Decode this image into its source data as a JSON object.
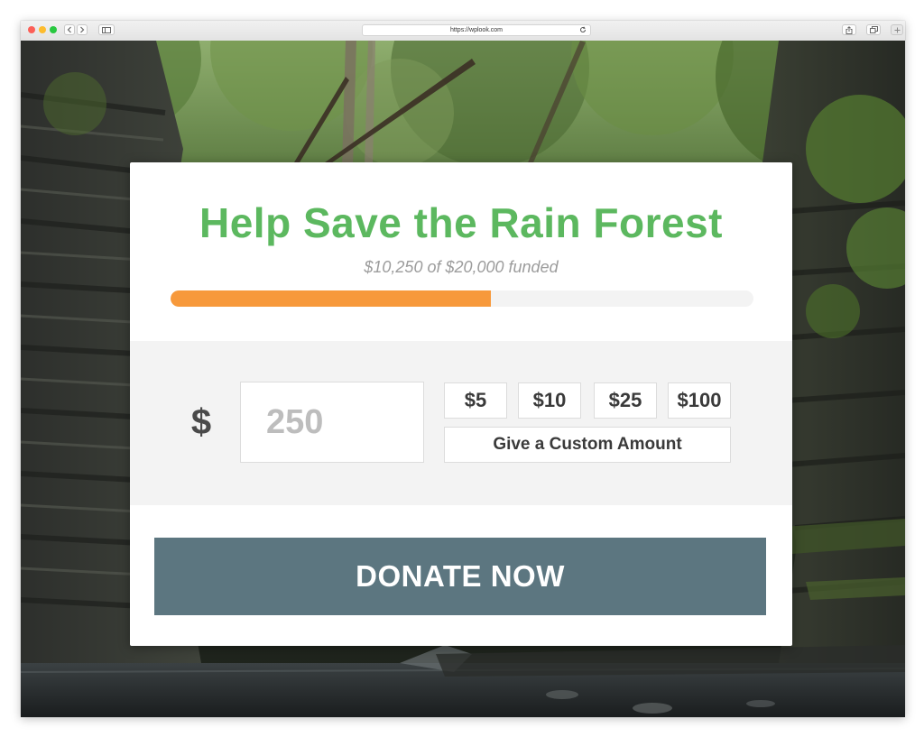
{
  "browser": {
    "url": "https://wplook.com",
    "icons": {
      "back": "chevron-left-icon",
      "forward": "chevron-right-icon",
      "sidebar": "sidebar-icon",
      "reload": "reload-icon",
      "share": "share-icon",
      "tabs": "tabs-icon",
      "new_tab": "plus-icon"
    }
  },
  "donation": {
    "title": "Help Save the Rain Forest",
    "funded_text": "$10,250 of $20,000 funded",
    "progress_fraction": 0.55,
    "currency_symbol": "$",
    "amount_placeholder": "250",
    "preset_amounts": [
      "$5",
      "$10",
      "$25",
      "$100"
    ],
    "custom_label": "Give a Custom Amount",
    "donate_label": "DONATE NOW"
  },
  "colors": {
    "title_green": "#5cb85f",
    "progress_orange": "#f7993b",
    "donate_slate": "#5c7680"
  }
}
